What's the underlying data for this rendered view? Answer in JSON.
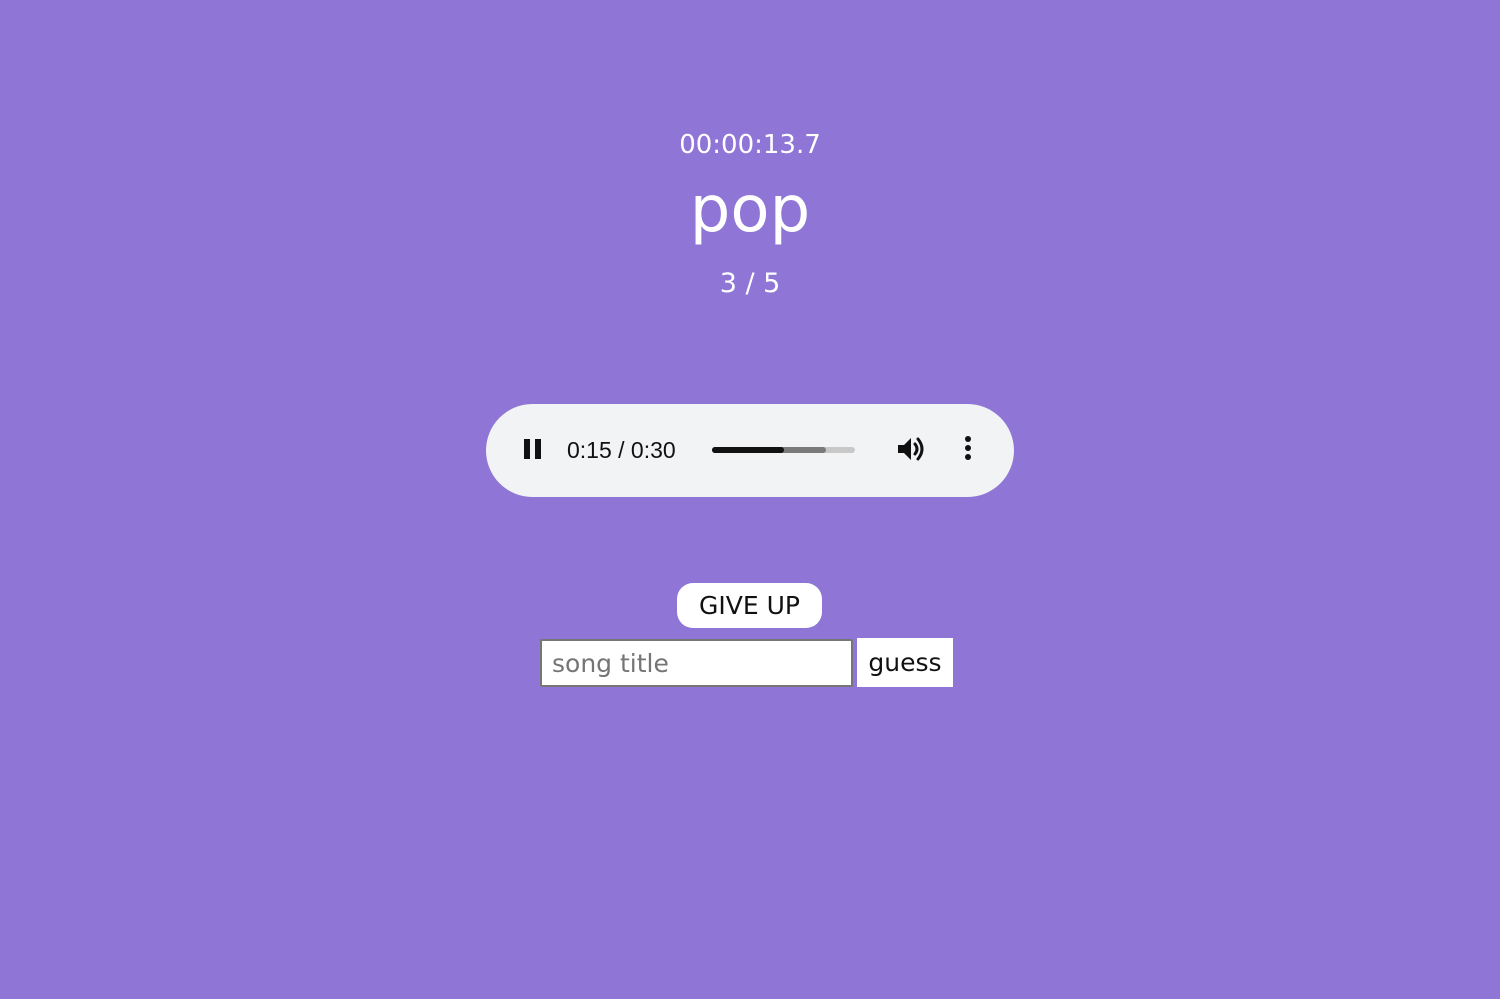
{
  "game": {
    "timer": "00:00:13.7",
    "genre": "pop",
    "round": "3 / 5"
  },
  "audio_player": {
    "state": "playing",
    "play_pause_icon": "pause-icon",
    "time_display": "0:15 / 0:30",
    "progress_fraction": 0.5,
    "buffered_fraction": 0.8,
    "volume_icon": "volume-icon",
    "menu_icon": "more-vertical-icon"
  },
  "actions": {
    "give_up_label": "GIVE UP",
    "title_input_placeholder": "song title",
    "title_input_value": "",
    "guess_label": "guess"
  },
  "colors": {
    "background": "#8e75d6",
    "player_background": "#f1f3f4",
    "text": "#ffffff"
  }
}
